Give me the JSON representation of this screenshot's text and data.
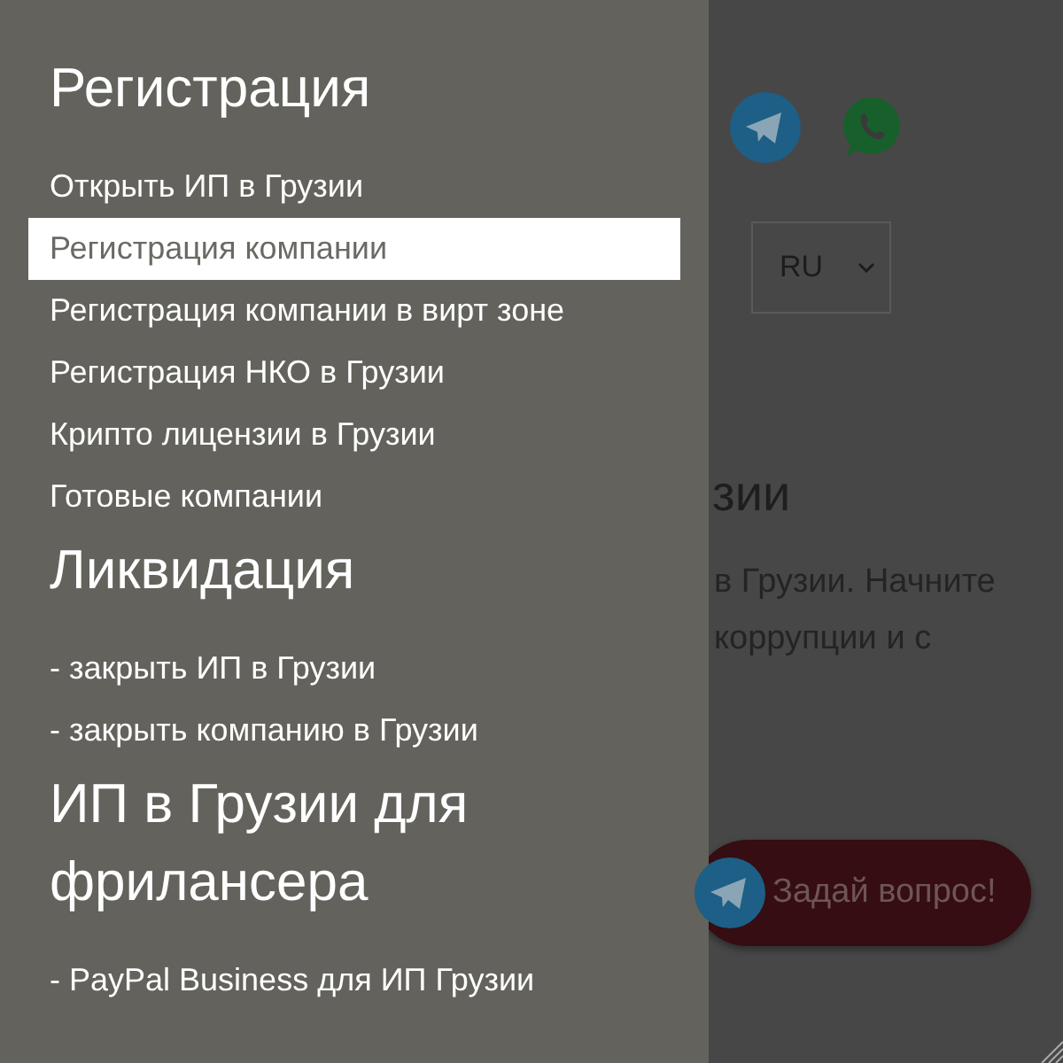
{
  "drawer": {
    "sections": [
      {
        "title": "Регистрация",
        "items": [
          {
            "label": "Открыть ИП в Грузии",
            "selected": false
          },
          {
            "label": "Регистрация компании",
            "selected": true
          },
          {
            "label": "Регистрация компании в вирт зоне",
            "selected": false
          },
          {
            "label": "Регистрация НКО в Грузии",
            "selected": false
          },
          {
            "label": "Крипто лицензии в Грузии",
            "selected": false
          },
          {
            "label": "Готовые компании",
            "selected": false
          }
        ]
      },
      {
        "title": "Ликвидация",
        "items": [
          {
            "label": "- закрыть ИП в Грузии",
            "selected": false
          },
          {
            "label": "- закрыть компанию в Грузии",
            "selected": false
          }
        ]
      },
      {
        "title": "ИП в Грузии для фрилансера",
        "items": [
          {
            "label": "- PayPal Business для ИП Грузии",
            "selected": false
          }
        ]
      }
    ]
  },
  "page": {
    "language_select": {
      "value": "RU"
    },
    "heading": "зии",
    "paragraph_lines": [
      "в Грузии. Начните",
      "коррупции и с"
    ],
    "ask_button": "Задай вопрос!"
  }
}
